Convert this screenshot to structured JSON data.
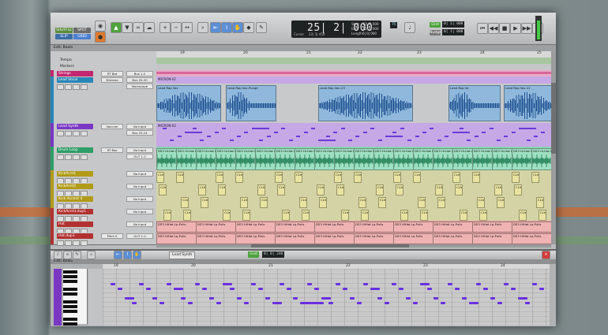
{
  "toolbar": {
    "modes": [
      "SHUFFLE",
      "SPOT",
      "SLIP",
      "GRID"
    ],
    "counter": {
      "main": "25| 2| 000",
      "sub_main": "Cursor",
      "sub_value": "22| 3| 450",
      "labels": [
        "Start",
        "End",
        "Length"
      ],
      "values": [
        "22| 3| 000",
        "22| 3| 000",
        "0| 0| 000"
      ]
    },
    "grid_label": "Grid",
    "grid_value": "0| 1| 000",
    "nudge_label": "Nudge",
    "nudge_value": "0| 1| 000",
    "tempo_val": "75"
  },
  "edit_window_title": "Edit: Beats",
  "ruler_labels": [
    "Tempo",
    "Markers"
  ],
  "bars": [
    "19",
    "20",
    "21",
    "22",
    "23",
    "24",
    "25"
  ],
  "tracks": [
    {
      "name": "Strings",
      "color": "#c3276f",
      "io": "Bus 1-2",
      "ins": "RT Bat"
    },
    {
      "name": "Lead Vocal",
      "color": "#2787b6",
      "io": "Bus 20-30",
      "ins": "Distress",
      "extra": "Mainscope"
    },
    {
      "name": "Lead Synth",
      "color": "#7a37c4",
      "io": "No Input",
      "ins": "Vaccum",
      "extra": "Bus 23-24"
    },
    {
      "name": "Drum Loop",
      "color": "#2d9e67",
      "io": "No Input",
      "ins": "RT Bas",
      "extra": "OUT 1-2"
    },
    {
      "name": "KickAcnt1",
      "color": "#b19b18",
      "io": "No Input",
      "ins": ""
    },
    {
      "name": "KickAcnt2",
      "color": "#b19b18",
      "io": "No Input",
      "ins": ""
    },
    {
      "name": "Kick Accent 4",
      "color": "#b19b18",
      "io": "No Input",
      "ins": ""
    },
    {
      "name": "KickAcnt3.dup1",
      "color": "#b23232",
      "io": "No Input",
      "ins": ""
    },
    {
      "name": "Hat",
      "color": "#b23232",
      "io": "No Input",
      "ins": ""
    },
    {
      "name": "Hat.dup1",
      "color": "#b23232",
      "io": "OUT 1-2",
      "ins": "Pitch II"
    }
  ],
  "clips": {
    "midi_top": "MICRON-02",
    "vocal": [
      "Lead Rap Voc",
      "Lead Rap Voc-Punge",
      "Lead Rap Voc-23",
      "Lead Rap Vo",
      "Lead Rap Voc-11"
    ],
    "drum": "DS3 Hi-Hat Lp-Pulls-Att",
    "kick": "CLIs",
    "hat": "DS3 HiHat Lp-Pulls"
  },
  "bottom": {
    "title": "Edit: Beats",
    "track_select": "Lead Synth",
    "grid_label": "Grid",
    "grid_value": "0| 0| 240",
    "bars": [
      "19",
      "20",
      "21",
      "22",
      "23",
      "24"
    ]
  },
  "colors": {
    "vocal_lane": "#8fb8dc",
    "synth_lane": "#c6a8e6",
    "drum_lane": "#8ed3b4",
    "kick_lane": "#d4d3a6",
    "hat_lane": "#e3a1a1",
    "strings_lane": "#e9aac5"
  }
}
